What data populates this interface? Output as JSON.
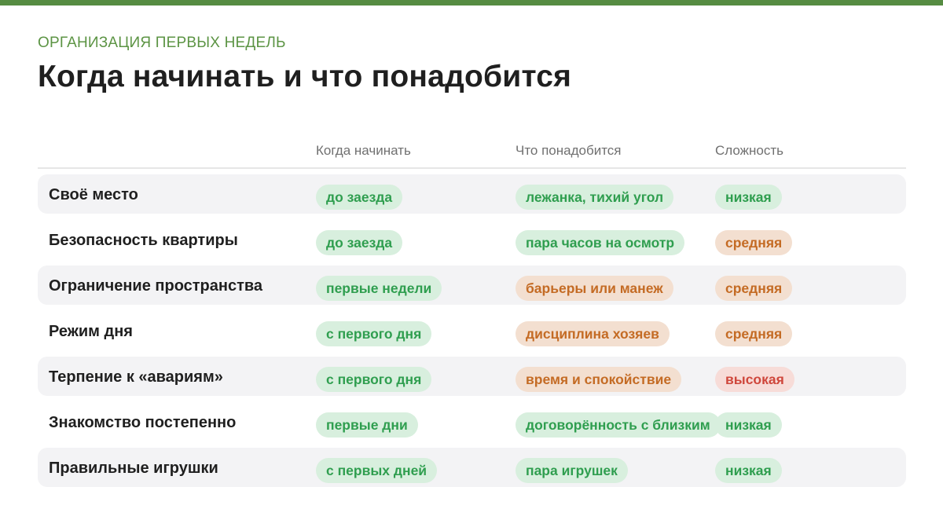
{
  "header": {
    "eyebrow": "ОРГАНИЗАЦИЯ ПЕРВЫХ НЕДЕЛЬ",
    "title": "Когда начинать и что понадобится"
  },
  "colors": {
    "accent": "#568c42",
    "green_text": "#2f9e4f",
    "orange_text": "#c46b24",
    "red_text": "#cf473c"
  },
  "table": {
    "columns": [
      "Когда начинать",
      "Что понадобится",
      "Сложность"
    ],
    "rows": [
      {
        "label": "Своё место",
        "when": "до заезда",
        "need": "лежанка, тихий угол",
        "difficulty": "низкая",
        "when_tone": "green",
        "need_tone": "green",
        "difficulty_tone": "green"
      },
      {
        "label": "Безопасность квартиры",
        "when": "до заезда",
        "need": "пара часов на осмотр",
        "difficulty": "средняя",
        "when_tone": "green",
        "need_tone": "green",
        "difficulty_tone": "orange"
      },
      {
        "label": "Ограничение пространства",
        "when": "первые недели",
        "need": "барьеры или манеж",
        "difficulty": "средняя",
        "when_tone": "green",
        "need_tone": "orange",
        "difficulty_tone": "orange"
      },
      {
        "label": "Режим дня",
        "when": "с первого дня",
        "need": "дисциплина хозяев",
        "difficulty": "средняя",
        "when_tone": "green",
        "need_tone": "orange",
        "difficulty_tone": "orange"
      },
      {
        "label": "Терпение к «авариям»",
        "when": "с первого дня",
        "need": "время и спокойствие",
        "difficulty": "высокая",
        "when_tone": "green",
        "need_tone": "orange",
        "difficulty_tone": "red"
      },
      {
        "label": "Знакомство постепенно",
        "when": "первые дни",
        "need": "договорённость с близким",
        "difficulty": "низкая",
        "when_tone": "green",
        "need_tone": "green",
        "difficulty_tone": "green"
      },
      {
        "label": "Правильные игрушки",
        "when": "с первых дней",
        "need": "пара игрушек",
        "difficulty": "низкая",
        "when_tone": "green",
        "need_tone": "green",
        "difficulty_tone": "green"
      }
    ]
  }
}
